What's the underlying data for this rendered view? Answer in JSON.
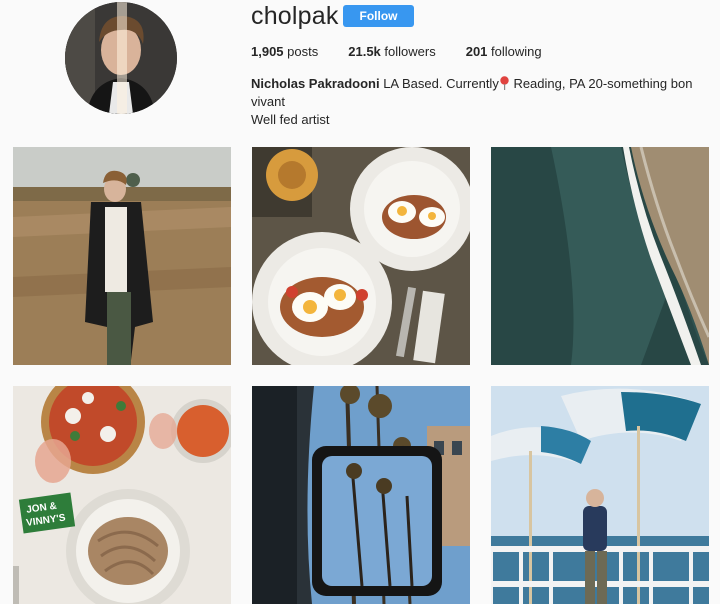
{
  "profile": {
    "username": "cholpak",
    "follow_label": "Follow",
    "stats": {
      "posts_count": "1,905",
      "posts_label": "posts",
      "followers_count": "21.5k",
      "followers_label": "followers",
      "following_count": "201",
      "following_label": "following"
    },
    "bio": {
      "full_name": "Nicholas Pakradooni",
      "line1_before_pin": " LA Based. Currently",
      "pin_icon": "round-pushpin-icon",
      "line1_after_pin": " Reading, PA 20-something bon vivant",
      "line2": "Well fed artist"
    }
  },
  "posts": [
    {
      "subject": "man-in-cornfield-photo"
    },
    {
      "subject": "breakfast-plates-photo"
    },
    {
      "subject": "beach-shoreline-photo"
    },
    {
      "subject": "pizza-pasta-table-photo",
      "sign_line1": "JON &",
      "sign_line2": "VINNY'S"
    },
    {
      "subject": "palm-trees-mirror-photo"
    },
    {
      "subject": "beach-umbrellas-photo"
    }
  ],
  "colors": {
    "follow_button": "#3897f0",
    "text": "#262626",
    "background": "#fafafa"
  }
}
